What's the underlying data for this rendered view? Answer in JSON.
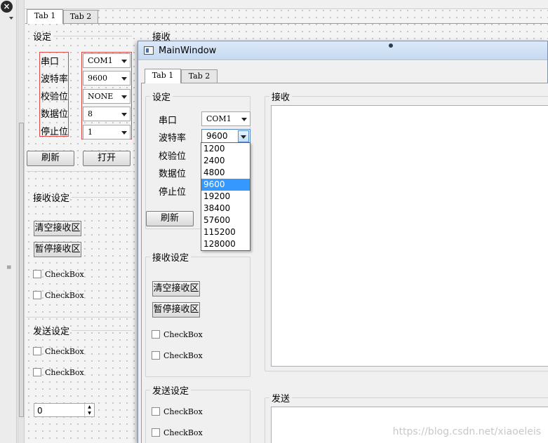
{
  "strip": {
    "close_glyph": "×"
  },
  "designer": {
    "tabs": [
      "Tab 1",
      "Tab 2"
    ],
    "settings_title": "设定",
    "labels": [
      "串口",
      "波特率",
      "校验位",
      "数据位",
      "停止位"
    ],
    "combos": [
      "COM1",
      "9600",
      "NONE",
      "8",
      "1"
    ],
    "refresh_button": "刷新",
    "open_button": "打开",
    "receive_settings_title": "接收设定",
    "clear_receive_button": "清空接收区",
    "pause_receive_button": "暂停接收区",
    "checkbox_label": "CheckBox",
    "send_settings_title": "发送设定",
    "spin_value": "0",
    "receive_title": "接收"
  },
  "main_window": {
    "title": "MainWindow",
    "tabs": [
      "Tab 1",
      "Tab 2"
    ],
    "settings_title": "设定",
    "labels": [
      "串口",
      "波特率",
      "校验位",
      "数据位",
      "停止位"
    ],
    "port_value": "COM1",
    "baud_value": "9600",
    "baud_options": [
      "1200",
      "2400",
      "4800",
      "9600",
      "19200",
      "38400",
      "57600",
      "115200",
      "128000"
    ],
    "baud_selected": "9600",
    "refresh_button": "刷新",
    "receive_settings_title": "接收设定",
    "clear_receive_button": "清空接收区",
    "pause_receive_button": "暂停接收区",
    "checkbox_label": "CheckBox",
    "send_settings_title": "发送设定",
    "receive_title": "接收",
    "send_title": "发送"
  },
  "watermark": "https://blog.csdn.net/xiaoeleis",
  "colors": {
    "selection": "#3399ff",
    "layout_outline": "#e04848",
    "title_bar": "#c6d9f0"
  }
}
